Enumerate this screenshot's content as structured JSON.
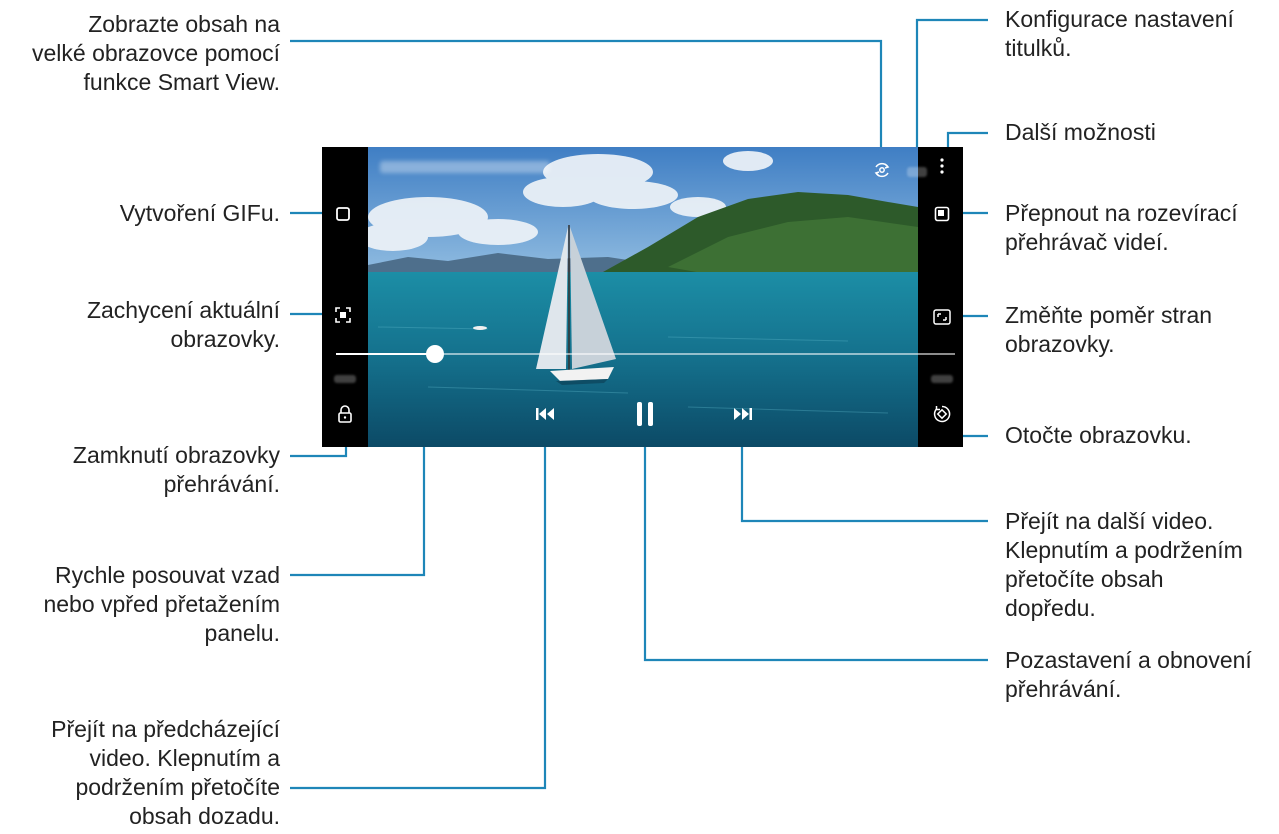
{
  "callouts": {
    "smart_view": "Zobrazte obsah na\nvelké obrazovce pomocí\nfunkce Smart View.",
    "gif": "Vytvoření GIFu.",
    "capture": "Zachycení aktuální\nobrazovky.",
    "lock": "Zamknutí obrazovky\npřehrávání.",
    "seek": "Rychle posouvat vzad\nnebo vpřed přetažením\npanelu.",
    "previous": "Přejít na předcházející\nvideo. Klepnutím a\npodržením přetočíte\nobsah dozadu.",
    "subtitles": "Konfigurace nastavení\ntitulků.",
    "more": "Další možnosti",
    "popup": "Přepnout na rozevírací\npřehrávač videí.",
    "ratio": "Změňte poměr stran\nobrazovky.",
    "rotate": "Otočte obrazovku.",
    "next": "Přejít na další video.\nKlepnutím a podržením\npřetočíte obsah\ndopředu.",
    "pause": "Pozastavení a obnovení\npřehrávání."
  },
  "player": {
    "progress": 0.16
  },
  "colors": {
    "callout_line": "#1e86b8",
    "text": "#222222"
  }
}
